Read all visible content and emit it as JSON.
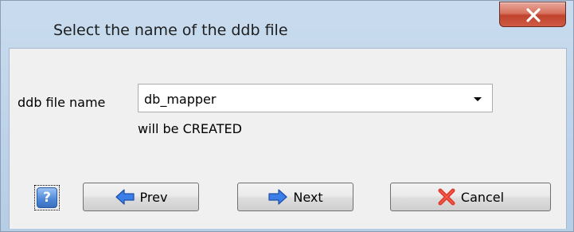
{
  "window": {
    "title": "Select the name of the ddb file",
    "close_icon": "close-x-icon"
  },
  "form": {
    "label": "ddb file name",
    "combo_value": "db_mapper",
    "status": "will be CREATED"
  },
  "buttons": {
    "help_icon": "help-question-icon",
    "help_glyph": "?",
    "prev_label": "Prev",
    "next_label": "Next",
    "cancel_label": "Cancel"
  },
  "colors": {
    "accent_blue": "#2f6fd6",
    "cancel_red": "#d93025",
    "close_red": "#c0422c"
  }
}
